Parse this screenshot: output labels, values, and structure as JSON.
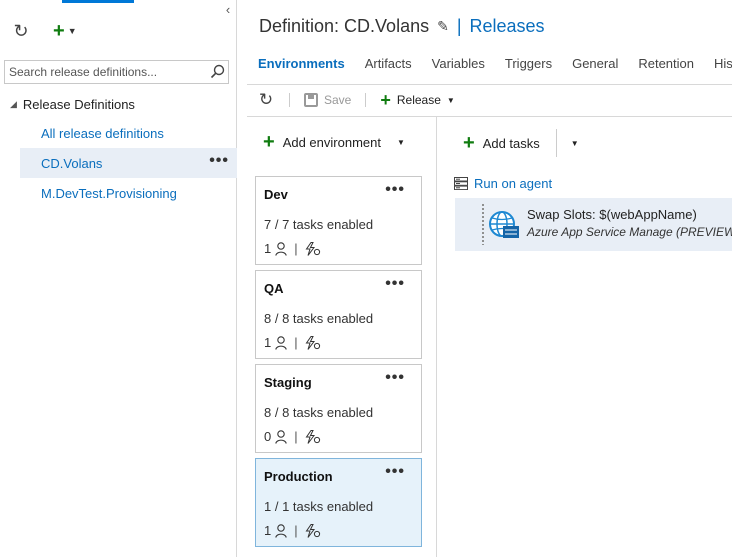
{
  "sidebar": {
    "collapse_glyph": "‹",
    "search_placeholder": "Search release definitions...",
    "tree_root": "Release Definitions",
    "items": [
      {
        "label": "All release definitions"
      },
      {
        "label": "CD.Volans",
        "selected": true
      },
      {
        "label": "M.DevTest.Provisioning"
      }
    ],
    "more_glyph": "•••"
  },
  "header": {
    "title": "Definition: CD.Volans",
    "separator": "|",
    "releases_link": "Releases"
  },
  "tabs": [
    {
      "label": "Environments",
      "active": true
    },
    {
      "label": "Artifacts"
    },
    {
      "label": "Variables"
    },
    {
      "label": "Triggers"
    },
    {
      "label": "General"
    },
    {
      "label": "Retention"
    },
    {
      "label": "History"
    }
  ],
  "toolbar": {
    "save_label": "Save",
    "release_label": "Release"
  },
  "environments": {
    "add_label": "Add environment",
    "cards": [
      {
        "name": "Dev",
        "tasks": "7 / 7 tasks enabled",
        "approvers": "1"
      },
      {
        "name": "QA",
        "tasks": "8 / 8 tasks enabled",
        "approvers": "1"
      },
      {
        "name": "Staging",
        "tasks": "8 / 8 tasks enabled",
        "approvers": "0"
      },
      {
        "name": "Production",
        "tasks": "1 / 1 tasks enabled",
        "approvers": "1",
        "selected": true
      }
    ]
  },
  "tasks_pane": {
    "add_label": "Add tasks",
    "run_on_agent": "Run on agent",
    "task": {
      "title": "Swap Slots: $(webAppName)",
      "subtitle": "Azure App Service Manage (PREVIEW)"
    }
  },
  "colors": {
    "accent_blue": "#0a6ebd",
    "add_green": "#107c10",
    "selected_bg": "#e6f2fa"
  }
}
